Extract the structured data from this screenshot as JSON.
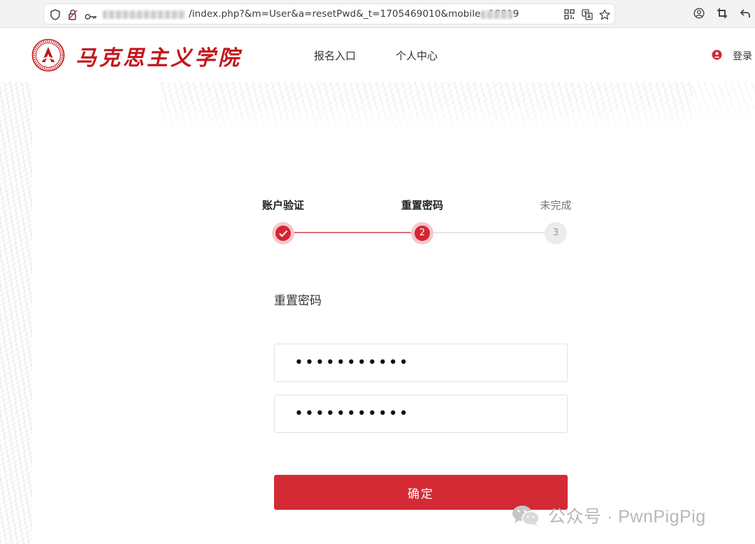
{
  "browser": {
    "url_text": "/index.php?&m=User&a=resetPwd&_t=1705469010&mobile=18819"
  },
  "header": {
    "site_name": "马克思主义学院",
    "nav": [
      "报名入口",
      "个人中心"
    ],
    "login_label": "登录"
  },
  "steps": [
    {
      "label": "账户验证",
      "state": "done"
    },
    {
      "label": "重置密码",
      "state": "active",
      "number": "2"
    },
    {
      "label": "未完成",
      "state": "todo",
      "number": "3"
    }
  ],
  "form": {
    "title": "重置密码",
    "password_value": "•••••••••••",
    "confirm_password_value": "•••••••••••",
    "submit_label": "确定"
  },
  "watermark": {
    "text": "公众号 · PwnPigPig"
  },
  "colors": {
    "accent": "#d42a35",
    "brand_red": "#c4161c",
    "step_done_ring": "#f5c8cc",
    "step_todo": "#ececec"
  },
  "icons": {
    "browser": [
      "shield-icon",
      "lock-icon",
      "key-icon",
      "qr-code-icon",
      "translate-icon",
      "star-icon",
      "account-icon",
      "crop-icon",
      "back-icon"
    ],
    "header": [
      "college-emblem",
      "user-icon"
    ],
    "steps": [
      "check-icon"
    ],
    "watermark": [
      "wechat-icon"
    ]
  }
}
